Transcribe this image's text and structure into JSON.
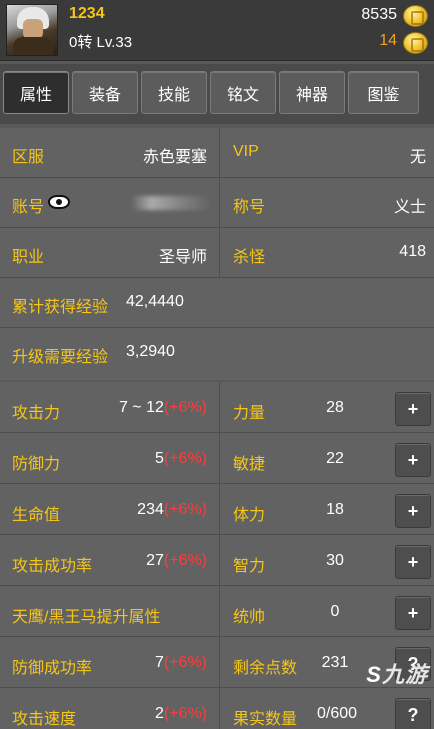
{
  "header": {
    "username": "1234",
    "level": "0转 Lv.33",
    "gold": "8535",
    "gems": "14"
  },
  "tabs": [
    {
      "label": "属性",
      "active": true
    },
    {
      "label": "装备",
      "active": false
    },
    {
      "label": "技能",
      "active": false
    },
    {
      "label": "铭文",
      "active": false
    },
    {
      "label": "神器",
      "active": false
    },
    {
      "label": "图鉴",
      "active": false
    }
  ],
  "info": {
    "server_label": "区服",
    "server_value": "赤色要塞",
    "vip_label": "VIP",
    "vip_value": "无",
    "account_label": "账号",
    "title_label": "称号",
    "title_value": "义士",
    "job_label": "职业",
    "job_value": "圣导师",
    "kills_label": "杀怪",
    "kills_value": "418",
    "exp_total_label": "累计获得经验",
    "exp_total_value": "42,4440",
    "exp_need_label": "升级需要经验",
    "exp_need_value": "3,2940"
  },
  "stats_left": [
    {
      "label": "攻击力",
      "value": "7 ~ 12",
      "bonus": "(+6%)"
    },
    {
      "label": "防御力",
      "value": "5",
      "bonus": "(+6%)"
    },
    {
      "label": "生命值",
      "value": "234",
      "bonus": "(+6%)"
    },
    {
      "label": "攻击成功率",
      "value": "27",
      "bonus": "(+6%)"
    },
    {
      "label": "天鹰/黑王马提升属性",
      "value": "",
      "bonus": ""
    },
    {
      "label": "防御成功率",
      "value": "7",
      "bonus": "(+6%)"
    },
    {
      "label": "攻击速度",
      "value": "2",
      "bonus": "(+6%)"
    }
  ],
  "stats_right": [
    {
      "label": "力量",
      "value": "28",
      "button": "+"
    },
    {
      "label": "敏捷",
      "value": "22",
      "button": "+"
    },
    {
      "label": "体力",
      "value": "18",
      "button": "+"
    },
    {
      "label": "智力",
      "value": "30",
      "button": "+"
    },
    {
      "label": "统帅",
      "value": "0",
      "button": "+"
    },
    {
      "label": "剩余点数",
      "value": "231",
      "button": "?"
    },
    {
      "label": "果实数量",
      "value": "0/600",
      "button": "?"
    }
  ],
  "watermark": "九游",
  "colors": {
    "label": "#f5c518",
    "bonus": "#ff3b3b",
    "background": "#626262"
  }
}
